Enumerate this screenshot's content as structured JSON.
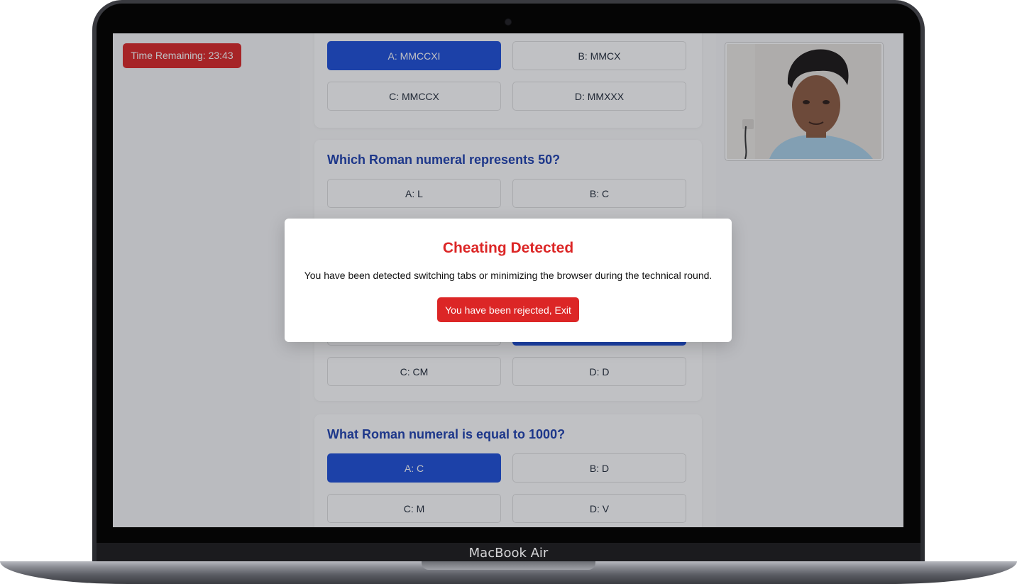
{
  "device": {
    "label": "MacBook Air"
  },
  "timer": {
    "text": "Time Remaining: 23:43"
  },
  "questions": [
    {
      "text": "",
      "options": [
        "A: MMCCXI",
        "B: MMCX",
        "C: MMCCX",
        "D: MMXXX"
      ],
      "selected": 0
    },
    {
      "text": "Which Roman numeral represents 50?",
      "options": [
        "A: L",
        "B: C",
        "",
        ""
      ],
      "selected": 1,
      "partial_options": [
        "C: CM",
        "D: D"
      ]
    },
    {
      "text": "What Roman numeral is equal to 1000?",
      "options": [
        "A: C",
        "B: D",
        "C: M",
        "D: V"
      ],
      "selected": 0
    }
  ],
  "modal": {
    "title": "Cheating Detected",
    "message": "You have been detected switching tabs or minimizing the browser during the technical round.",
    "button_label": "You have been rejected, Exit"
  },
  "colors": {
    "accent": "#1d4ed8",
    "danger": "#dc2626",
    "question": "#1e40af"
  },
  "icons": {
    "webcam": "webcam-feed"
  }
}
